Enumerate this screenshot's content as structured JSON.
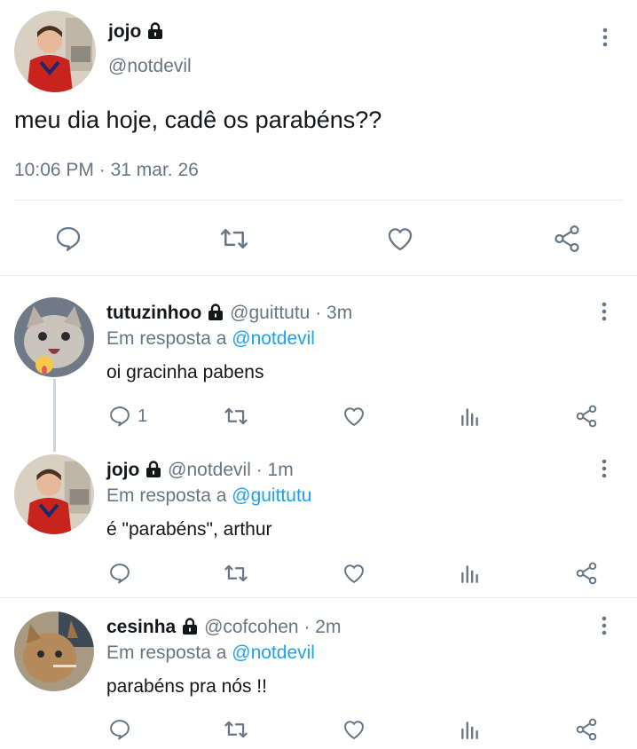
{
  "main_tweet": {
    "display_name": "jojo",
    "handle": "@notdevil",
    "text": "meu dia hoje, cadê os parabéns??",
    "time": "10:06 PM",
    "date_sep": "·",
    "date": "31 mar. 26"
  },
  "replies": [
    {
      "display_name": "tutuzinhoo",
      "handle": "@guittutu",
      "time": "· 3m",
      "reply_prefix": "Em resposta a",
      "reply_to": "@notdevil",
      "text": "oi gracinha pabens",
      "reply_count": "1"
    },
    {
      "display_name": "jojo",
      "handle": "@notdevil",
      "time": "· 1m",
      "reply_prefix": "Em resposta a",
      "reply_to": "@guittutu",
      "text": "é \"parabéns\", arthur",
      "reply_count": ""
    },
    {
      "display_name": "cesinha",
      "handle": "@cofcohen",
      "time": "· 2m",
      "reply_prefix": "Em resposta a",
      "reply_to": "@notdevil",
      "text": "parabéns pra nós !!",
      "reply_count": ""
    }
  ],
  "icons": {
    "more": "more-vertical-icon",
    "reply": "reply-icon",
    "retweet": "retweet-icon",
    "like": "heart-icon",
    "stats": "analytics-icon",
    "share": "share-icon",
    "lock": "lock-icon"
  },
  "colors": {
    "text": "#14171a",
    "muted": "#657786",
    "link": "#1da1f2",
    "icon": "#657786",
    "divider": "#e6ecf0"
  }
}
